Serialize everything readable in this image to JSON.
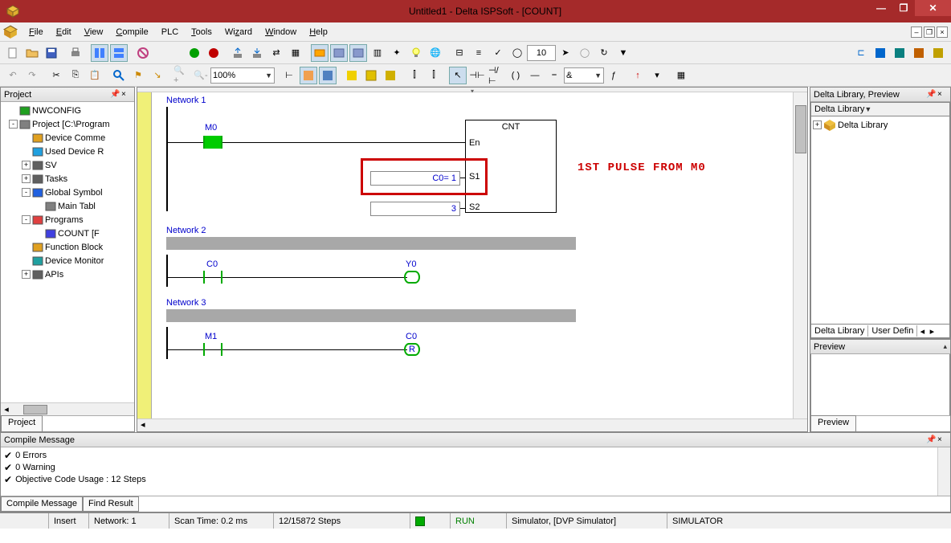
{
  "window": {
    "title": "Untitled1 - Delta ISPSoft - [COUNT]"
  },
  "menu": {
    "file": "File",
    "edit": "Edit",
    "view": "View",
    "compile": "Compile",
    "plc": "PLC",
    "tools": "Tools",
    "wizard": "Wizard",
    "window": "Window",
    "help": "Help"
  },
  "toolbar": {
    "ms_value": "10",
    "zoom": "100%",
    "op_combo": "&"
  },
  "project": {
    "title": "Project",
    "items": [
      {
        "indent": 0,
        "exp": "",
        "icon": "nwconfig",
        "label": "NWCONFIG"
      },
      {
        "indent": 0,
        "exp": "-",
        "icon": "project",
        "label": "Project [C:\\Program"
      },
      {
        "indent": 1,
        "exp": "",
        "icon": "devcomm",
        "label": "Device Comme"
      },
      {
        "indent": 1,
        "exp": "",
        "icon": "usedreg",
        "label": "Used Device R"
      },
      {
        "indent": 1,
        "exp": "+",
        "icon": "sv",
        "label": "SV"
      },
      {
        "indent": 1,
        "exp": "+",
        "icon": "tasks",
        "label": "Tasks"
      },
      {
        "indent": 1,
        "exp": "-",
        "icon": "globals",
        "label": "Global Symbol"
      },
      {
        "indent": 2,
        "exp": "",
        "icon": "table",
        "label": "Main Tabl"
      },
      {
        "indent": 1,
        "exp": "-",
        "icon": "programs",
        "label": "Programs"
      },
      {
        "indent": 2,
        "exp": "",
        "icon": "count",
        "label": "COUNT [F"
      },
      {
        "indent": 1,
        "exp": "",
        "icon": "fb",
        "label": "Function Block"
      },
      {
        "indent": 1,
        "exp": "",
        "icon": "devmon",
        "label": "Device Monitor"
      },
      {
        "indent": 1,
        "exp": "+",
        "icon": "apis",
        "label": "APIs"
      }
    ],
    "tab": "Project"
  },
  "editor": {
    "networks": [
      {
        "label": "Network 1",
        "contact": "M0",
        "fbox": {
          "title": "CNT",
          "ports": [
            "En",
            "S1",
            "S2"
          ]
        },
        "params": {
          "s1": "C0= 1",
          "s2": "3"
        },
        "annotation": "1ST PULSE FROM M0"
      },
      {
        "label": "Network 2",
        "contact": "C0",
        "coil": "Y0"
      },
      {
        "label": "Network 3",
        "contact": "M1",
        "coil": "C0",
        "coil_type": "R"
      }
    ]
  },
  "library": {
    "title": "Delta Library, Preview",
    "header": "Delta Library",
    "root": "Delta Library",
    "tabs": [
      "Delta Library",
      "User Defin"
    ],
    "preview_title": "Preview",
    "preview_tab": "Preview"
  },
  "compile": {
    "title": "Compile Message",
    "rows": [
      "0 Errors",
      "0 Warning",
      "Objective Code Usage : 12 Steps"
    ],
    "tabs": [
      "Compile Message",
      "Find Result"
    ]
  },
  "status": {
    "insert": "Insert",
    "network": "Network: 1",
    "scan": "Scan Time: 0.2 ms",
    "steps": "12/15872 Steps",
    "run": "RUN",
    "sim": "Simulator, [DVP Simulator]",
    "mode": "SIMULATOR"
  }
}
